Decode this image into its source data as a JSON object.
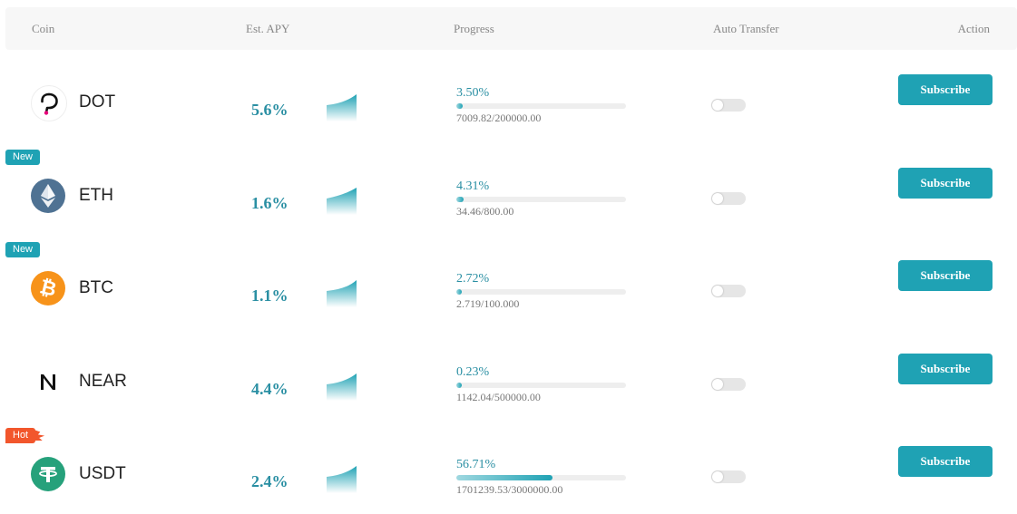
{
  "header": {
    "coin": "Coin",
    "apy": "Est. APY",
    "progress": "Progress",
    "auto_transfer": "Auto Transfer",
    "action": "Action"
  },
  "colors": {
    "accent": "#1fa2b4",
    "apy_text": "#2a8fa3",
    "badge_new": "#1fa2b4",
    "badge_hot": "#f2562c"
  },
  "rows": [
    {
      "badge": "",
      "badge_type": "",
      "icon": "polkadot-icon",
      "coin": "DOT",
      "apy": "5.6%",
      "progress_percent": "3.50%",
      "progress_fraction": 0.035,
      "amount": "7009.82/200000.00",
      "auto_transfer": false,
      "action": "Subscribe"
    },
    {
      "badge": "New",
      "badge_type": "new",
      "icon": "ethereum-icon",
      "coin": "ETH",
      "apy": "1.6%",
      "progress_percent": "4.31%",
      "progress_fraction": 0.0431,
      "amount": "34.46/800.00",
      "auto_transfer": false,
      "action": "Subscribe"
    },
    {
      "badge": "New",
      "badge_type": "new",
      "icon": "bitcoin-icon",
      "coin": "BTC",
      "apy": "1.1%",
      "progress_percent": "2.72%",
      "progress_fraction": 0.0272,
      "amount": "2.719/100.000",
      "auto_transfer": false,
      "action": "Subscribe"
    },
    {
      "badge": "",
      "badge_type": "",
      "icon": "near-icon",
      "coin": "NEAR",
      "apy": "4.4%",
      "progress_percent": "0.23%",
      "progress_fraction": 0.0023,
      "amount": "1142.04/500000.00",
      "auto_transfer": false,
      "action": "Subscribe"
    },
    {
      "badge": "Hot",
      "badge_type": "hot",
      "icon": "tether-icon",
      "coin": "USDT",
      "apy": "2.4%",
      "progress_percent": "56.71%",
      "progress_fraction": 0.5671,
      "amount": "1701239.53/3000000.00",
      "auto_transfer": false,
      "action": "Subscribe"
    }
  ]
}
